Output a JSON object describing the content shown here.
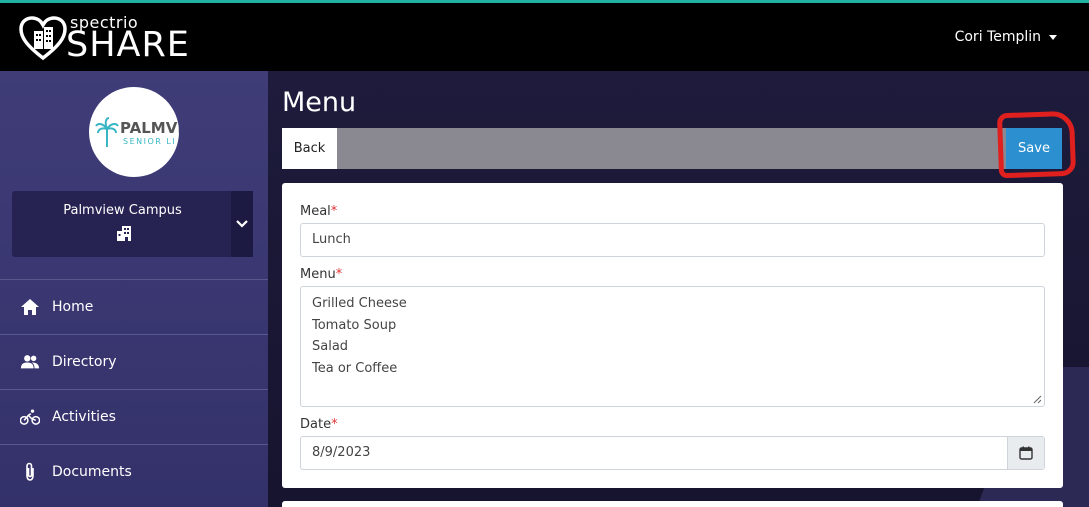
{
  "header": {
    "brand_small": "spectrio",
    "brand_big": "SHARE",
    "user_name": "Cori Templin"
  },
  "sidebar": {
    "campus_logo": {
      "name": "PALMVI",
      "sub": "SENIOR LI"
    },
    "campus_name": "Palmview Campus",
    "items": [
      {
        "label": "Home",
        "icon": "home-icon"
      },
      {
        "label": "Directory",
        "icon": "people-icon"
      },
      {
        "label": "Activities",
        "icon": "bicycle-icon"
      },
      {
        "label": "Documents",
        "icon": "paperclip-icon"
      }
    ]
  },
  "main": {
    "title": "Menu",
    "back_label": "Back",
    "save_label": "Save",
    "form": {
      "meal_label": "Meal",
      "meal_value": "Lunch",
      "menu_label": "Menu",
      "menu_lines": [
        "Grilled Cheese",
        "Tomato Soup",
        "Salad",
        "Tea or Coffee"
      ],
      "date_label": "Date",
      "date_value": "8/9/2023",
      "required_mark": "*"
    }
  },
  "colors": {
    "topbar": "#000000",
    "accent_line": "#20b2a2",
    "sidebar": "#3f3c78",
    "save_button": "#2c8fcf",
    "annotation": "#e0201e"
  }
}
